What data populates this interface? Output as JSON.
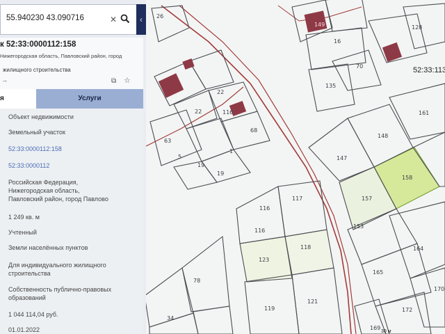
{
  "search": {
    "query": "55.940230 43.090716"
  },
  "card": {
    "title": "к 52:33:0000112:158",
    "address": "Нижегородская область, Павловский район, город",
    "purpose": "жилищного строительства",
    "arrow": "→"
  },
  "tabs": {
    "info_label": "я",
    "services_label": "Услуги"
  },
  "properties": [
    "Объект недвижимости",
    "Земельный участок",
    "52:33:0000112:158",
    "52:33:0000112",
    "Российская Федерация, Нижегородская область, Павловский район, город Павлово",
    "1 249 кв. м",
    "Учтенный",
    "Земли населённых пунктов",
    "Для индивидуального жилищного строительства",
    "Собственность публично-правовых образований",
    "1 044 114,04 руб.",
    "01.01.2022"
  ],
  "map": {
    "cadastral_quarter": "52:33:113",
    "parcel_numbers": [
      "26",
      "149",
      "16",
      "128",
      "70",
      "135",
      "161",
      "148",
      "147",
      "22",
      "22",
      "116",
      "68",
      "63",
      "5",
      "1",
      "19",
      "19",
      "116",
      "117",
      "116",
      "118",
      "123",
      "157",
      "153",
      "164",
      "165",
      "170",
      "172",
      "78",
      "34",
      "119",
      "121",
      "169",
      "158"
    ],
    "scale_label": "30 м",
    "colors": {
      "boundary_red": "#a33a3a",
      "building_fill": "#8e3a46",
      "selected_fill": "#d6e89a"
    }
  }
}
